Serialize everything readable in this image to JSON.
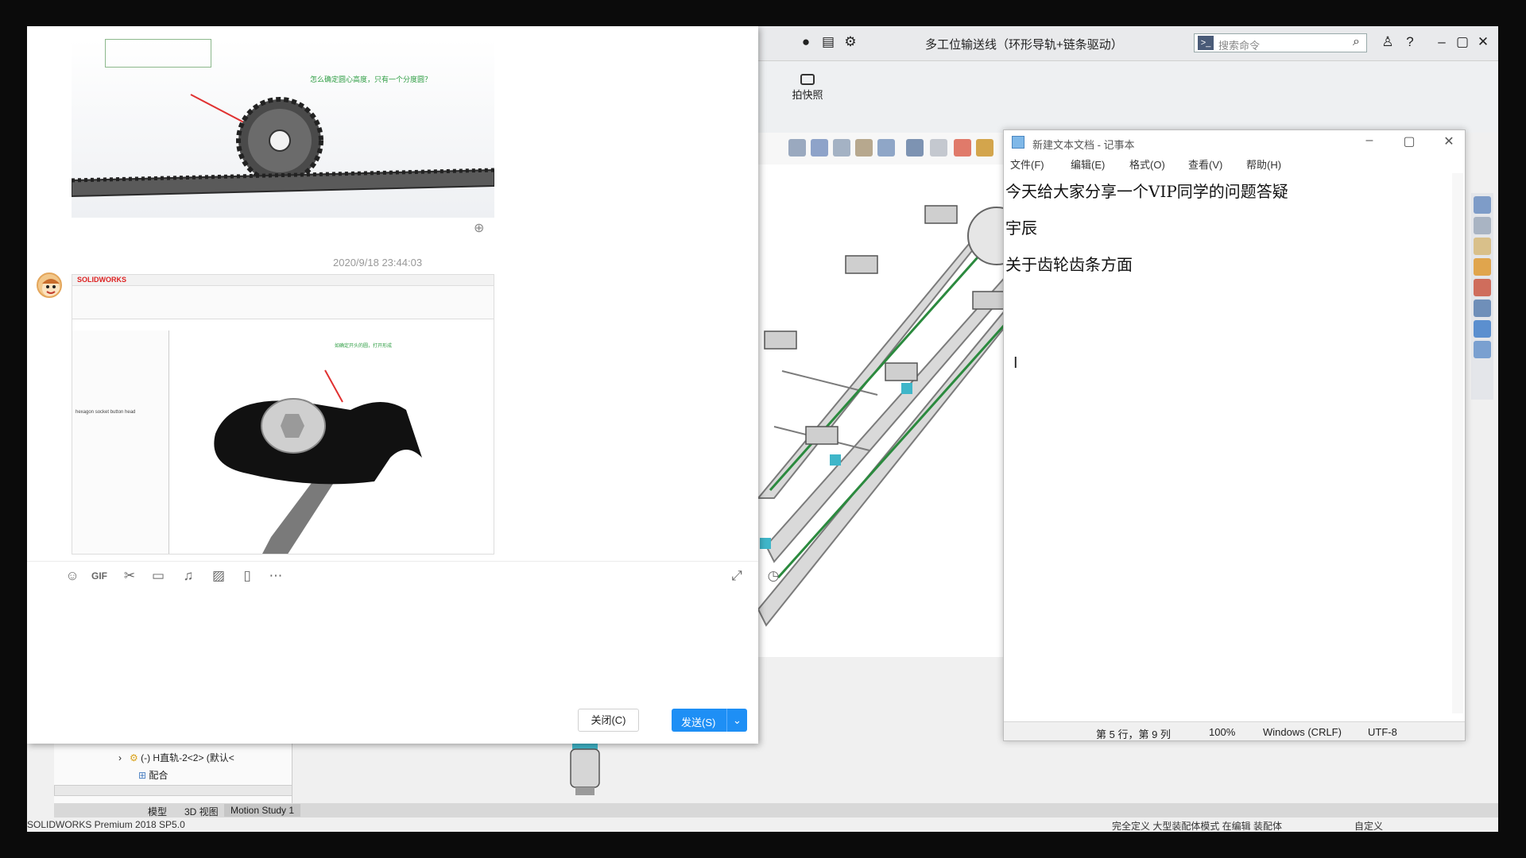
{
  "solidworks": {
    "title": "多工位输送线（环形导轨+链条驱动）",
    "search_placeholder": "搜索命令",
    "snapshot_label": "拍快照",
    "tree": {
      "row1": "(-) H直轨-2<2> (默认<",
      "row2": "配合"
    },
    "tabs": [
      "模型",
      "3D 视图",
      "Motion Study 1"
    ],
    "status_left": "SOLIDWORKS Premium 2018 SP5.0",
    "status_middle": "完全定义   大型装配体模式   在编辑 装配体",
    "status_right": "自定义"
  },
  "chat": {
    "image1_question": "怎么确定圆心高度，只有一个分度圆？",
    "timestamp": "2020/9/18 23:44:03",
    "image2_logo": "SOLIDWORKS",
    "image2_note": "如确定开头的圆，打开形成",
    "image2_tree_item": "hexagon socket button head",
    "close_label": "关闭(C)",
    "send_label": "发送(S)",
    "toolbar_icons": [
      "emoji-icon",
      "gif-icon",
      "scissors-icon",
      "folder-icon",
      "music-icon",
      "image-icon",
      "screen-icon",
      "more-icon"
    ]
  },
  "notepad": {
    "title": "新建文本文档 - 记事本",
    "menu": [
      "文件(F)",
      "编辑(E)",
      "格式(O)",
      "查看(V)",
      "帮助(H)"
    ],
    "lines": [
      "今天给大家分享一个VIP同学的问题答疑",
      "宇辰",
      "关于齿轮齿条方面"
    ],
    "status": {
      "position": "第 5 行，第 9 列",
      "zoom": "100%",
      "eol": "Windows (CRLF)",
      "encoding": "UTF-8"
    }
  },
  "colors": {
    "send_button": "#1e8ff5",
    "accent_green": "#2db46b"
  }
}
